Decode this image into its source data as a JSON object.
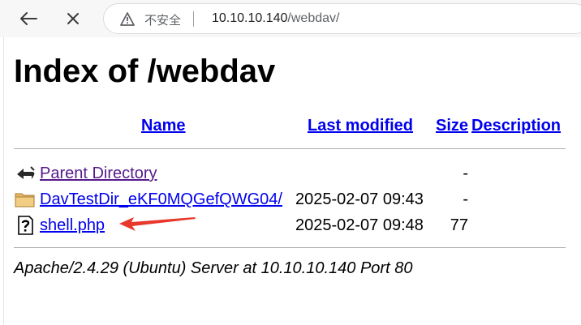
{
  "browser": {
    "security_label": "不安全",
    "url_host": "10.10.10.140",
    "url_path": "/webdav/"
  },
  "page": {
    "title": "Index of /webdav",
    "columns": {
      "name": "Name",
      "last_modified": "Last modified",
      "size": "Size",
      "description": "Description"
    },
    "rows": [
      {
        "icon": "back-icon",
        "name": "Parent Directory",
        "modified": "",
        "size": "-"
      },
      {
        "icon": "folder-icon",
        "name": "DavTestDir_eKF0MQGefQWG04/",
        "modified": "2025-02-07 09:43",
        "size": "-"
      },
      {
        "icon": "unknown-file-icon",
        "name": "shell.php",
        "modified": "2025-02-07 09:48",
        "size": "77"
      }
    ],
    "footer": "Apache/2.4.29 (Ubuntu) Server at 10.10.10.140 Port 80"
  },
  "colors": {
    "link": "#0000ee",
    "visited_link": "#551a8b",
    "annotation_arrow": "#e8372b"
  }
}
